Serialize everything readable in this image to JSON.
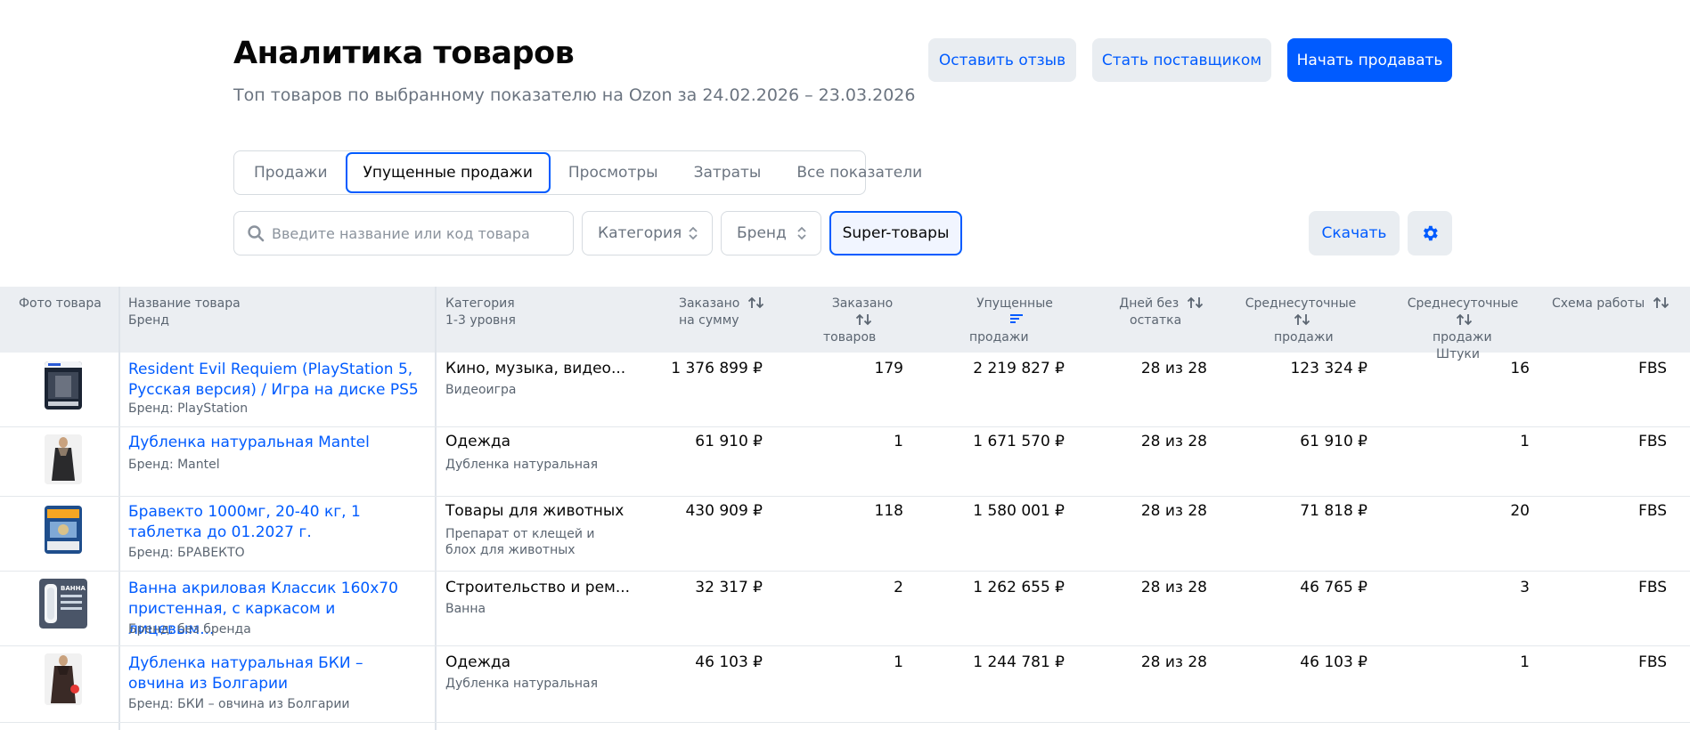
{
  "header": {
    "title": "Аналитика товаров",
    "subtitle": "Топ товаров по выбранному показателю на Ozon за 24.02.2026 – 23.03.2026",
    "feedback_button": "Оставить отзыв",
    "supplier_button": "Стать поставщиком",
    "sell_button": "Начать продавать"
  },
  "tabs": [
    {
      "label": "Продажи",
      "active": false
    },
    {
      "label": "Упущенные продажи",
      "active": true
    },
    {
      "label": "Просмотры",
      "active": false
    },
    {
      "label": "Затраты",
      "active": false
    },
    {
      "label": "Все показатели",
      "active": false
    }
  ],
  "filters": {
    "search_placeholder": "Введите название или код товара",
    "category": "Категория",
    "brand": "Бренд",
    "super": "Super-товары",
    "download": "Скачать"
  },
  "columns": {
    "photo": "Фото товара",
    "name": "Название товара",
    "name_sub": "Бренд",
    "category": "Категория",
    "category_sub": "1-3 уровня",
    "ordered_sum_1": "Заказано",
    "ordered_sum_2": "на сумму",
    "ordered_qty_1": "Заказано",
    "ordered_qty_2": "товаров",
    "lost_1": "Упущенные",
    "lost_2": "продажи",
    "days_1": "Дней без",
    "days_2": "остатка",
    "avg_1": "Среднесуточные",
    "avg_2": "продажи",
    "avgq_1": "Среднесуточные",
    "avgq_2": "продажи",
    "avgq_3": "Штуки",
    "scheme": "Схема работы"
  },
  "rows": [
    {
      "name": "Resident Evil Requiem (PlayStation 5, Русская версия) / Игра на диске PS5",
      "brand": "Бренд: PlayStation",
      "category": "Кино, музыка, видео...",
      "subcategory": "Видеоигра",
      "ordered_sum": "1 376 899 ₽",
      "ordered_qty": "179",
      "lost": "2 219 827 ₽",
      "days": "28 из 28",
      "avg": "123 324 ₽",
      "avgq": "16",
      "scheme": "FBS"
    },
    {
      "name": "Дубленка натуральная Mantel",
      "brand": "Бренд: Mantel",
      "category": "Одежда",
      "subcategory": "Дубленка натуральная",
      "ordered_sum": "61 910 ₽",
      "ordered_qty": "1",
      "lost": "1 671 570 ₽",
      "days": "28 из 28",
      "avg": "61 910 ₽",
      "avgq": "1",
      "scheme": "FBS"
    },
    {
      "name": "Бравекто 1000мг, 20-40 кг, 1 таблетка до 01.2027 г.",
      "brand": "Бренд: БРАВЕКТО",
      "category": "Товары для животных",
      "subcategory": "Препарат от клещей и блох для животных",
      "ordered_sum": "430 909 ₽",
      "ordered_qty": "118",
      "lost": "1 580 001 ₽",
      "days": "28 из 28",
      "avg": "71 818 ₽",
      "avgq": "20",
      "scheme": "FBS"
    },
    {
      "name": "Ванна акриловая Классик 160х70 пристенная, с каркасом и лицевым...",
      "brand": "Бренд: без бренда",
      "category": "Строительство и рем...",
      "subcategory": "Ванна",
      "ordered_sum": "32 317 ₽",
      "ordered_qty": "2",
      "lost": "1 262 655 ₽",
      "days": "28 из 28",
      "avg": "46 765 ₽",
      "avgq": "3",
      "scheme": "FBS"
    },
    {
      "name": "Дубленка натуральная БКИ – овчина из Болгарии",
      "brand": "Бренд: БКИ – овчина из Болгарии",
      "category": "Одежда",
      "subcategory": "Дубленка натуральная",
      "ordered_sum": "46 103 ₽",
      "ordered_qty": "1",
      "lost": "1 244 781 ₽",
      "days": "28 из 28",
      "avg": "46 103 ₽",
      "avgq": "1",
      "scheme": "FBS"
    }
  ],
  "thumb_labels": {
    "bath": "ВАННА"
  },
  "colors": {
    "accent": "#005bff",
    "header_bg": "#ebeef2",
    "button_light": "#e9edf1"
  }
}
